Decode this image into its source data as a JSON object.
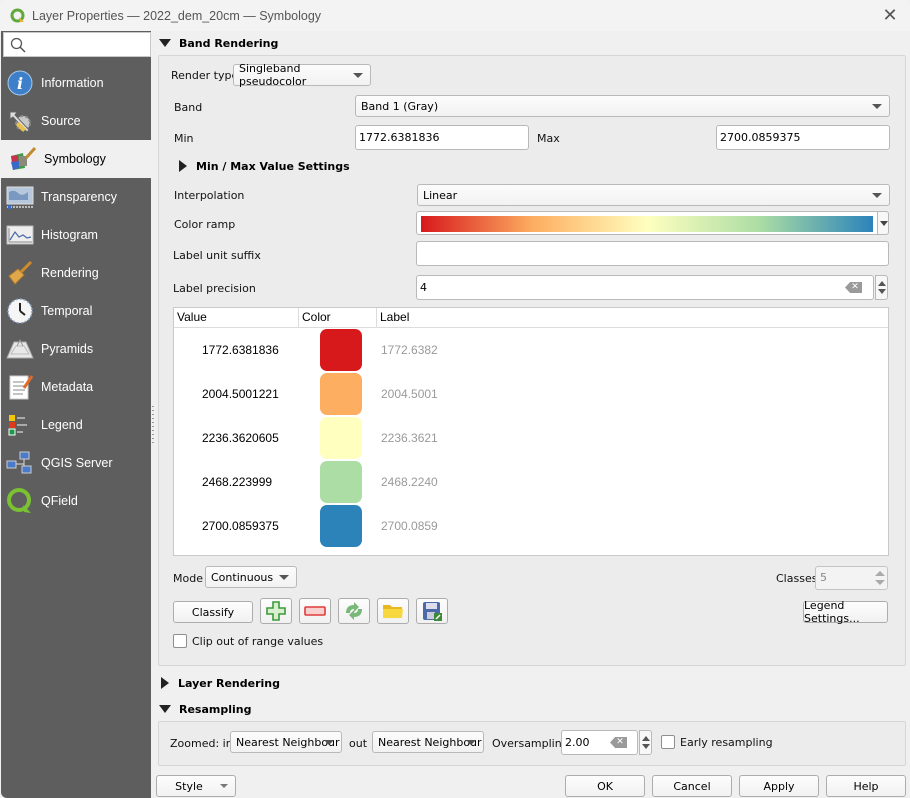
{
  "window": {
    "title": "Layer Properties — 2022_dem_20cm — Symbology",
    "app_icon": "qgis-logo-icon",
    "close_icon": "close-icon"
  },
  "sidebar": {
    "search_placeholder": "",
    "items": [
      {
        "label": "Information",
        "icon": "information-icon",
        "active": false
      },
      {
        "label": "Source",
        "icon": "source-icon",
        "active": false
      },
      {
        "label": "Symbology",
        "icon": "symbology-icon",
        "active": true
      },
      {
        "label": "Transparency",
        "icon": "transparency-icon",
        "active": false
      },
      {
        "label": "Histogram",
        "icon": "histogram-icon",
        "active": false
      },
      {
        "label": "Rendering",
        "icon": "rendering-icon",
        "active": false
      },
      {
        "label": "Temporal",
        "icon": "temporal-icon",
        "active": false
      },
      {
        "label": "Pyramids",
        "icon": "pyramids-icon",
        "active": false
      },
      {
        "label": "Metadata",
        "icon": "metadata-icon",
        "active": false
      },
      {
        "label": "Legend",
        "icon": "legend-icon",
        "active": false
      },
      {
        "label": "QGIS Server",
        "icon": "qgis-server-icon",
        "active": false
      },
      {
        "label": "QField",
        "icon": "qfield-icon",
        "active": false
      }
    ]
  },
  "band_rendering": {
    "header": "Band Rendering",
    "render_type_label": "Render type",
    "render_type_value": "Singleband pseudocolor",
    "band_label": "Band",
    "band_value": "Band 1 (Gray)",
    "min_label": "Min",
    "min_value": "1772.6381836",
    "max_label": "Max",
    "max_value": "2700.0859375",
    "minmax_settings_header": "Min / Max Value Settings",
    "interpolation_label": "Interpolation",
    "interpolation_value": "Linear",
    "color_ramp_label": "Color ramp",
    "color_ramp_stops": [
      "#d7191c",
      "#fdae61",
      "#ffffbf",
      "#abdda4",
      "#2b83ba"
    ],
    "label_unit_suffix_label": "Label unit suffix",
    "label_unit_suffix_value": "",
    "label_precision_label": "Label precision",
    "label_precision_value": "4",
    "table": {
      "columns": [
        "Value",
        "Color",
        "Label"
      ],
      "rows": [
        {
          "value": "1772.6381836",
          "color": "#d7191c",
          "label": "1772.6382"
        },
        {
          "value": "2004.5001221",
          "color": "#fdae61",
          "label": "2004.5001"
        },
        {
          "value": "2236.3620605",
          "color": "#ffffbf",
          "label": "2236.3621"
        },
        {
          "value": "2468.223999",
          "color": "#abdda4",
          "label": "2468.2240"
        },
        {
          "value": "2700.0859375",
          "color": "#2b83ba",
          "label": "2700.0859"
        }
      ]
    },
    "mode_label": "Mode",
    "mode_value": "Continuous",
    "classes_label": "Classes",
    "classes_value": "5",
    "classify_button": "Classify",
    "icon_buttons": [
      "add-class-icon",
      "remove-class-icon",
      "reverse-icon",
      "load-icon",
      "save-icon"
    ],
    "legend_settings_button": "Legend Settings...",
    "clip_checkbox_label": "Clip out of range values",
    "clip_checked": false
  },
  "layer_rendering": {
    "header": "Layer Rendering"
  },
  "resampling": {
    "header": "Resampling",
    "zoomed_in_label": "Zoomed: in",
    "zoomed_in_value": "Nearest Neighbour",
    "out_label": "out",
    "out_value": "Nearest Neighbour",
    "oversampling_label": "Oversampling",
    "oversampling_value": "2.00",
    "early_resampling_label": "Early resampling",
    "early_resampling_checked": false
  },
  "footer": {
    "style_button": "Style",
    "ok_button": "OK",
    "cancel_button": "Cancel",
    "apply_button": "Apply",
    "help_button": "Help"
  }
}
